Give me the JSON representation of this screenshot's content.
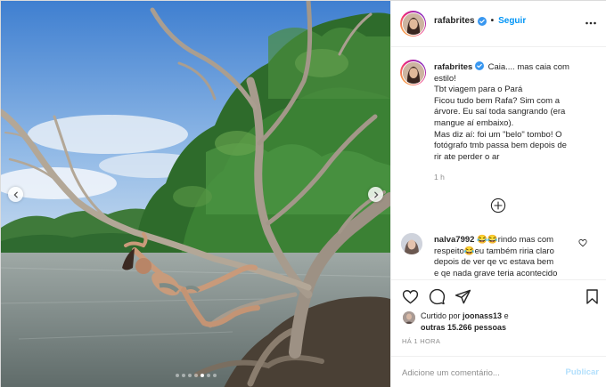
{
  "post": {
    "username": "rafabrites",
    "follow_label": "Seguir",
    "separator": "•",
    "caption_lines": [
      "Caia.... mas caia com",
      "estilo!",
      "Tbt viagem para o Pará",
      "Ficou tudo bem Rafa? Sim com a",
      "árvore. Eu saí toda sangrando (era",
      "mangue aí embaixo).",
      "Mas diz aí: foi um \"belo\" tombo! O",
      "fotógrafo tmb passa bem depois de",
      "rir ate perder o ar"
    ],
    "caption_time": "1 h",
    "carousel": {
      "total": 7,
      "active_index": 4
    }
  },
  "comment": {
    "username": "nalva7992",
    "lines": [
      "😂😂rindo mas com",
      "respeito😂eu também riria claro",
      "depois de ver qe vc estava bem",
      "e qe nada grave teria acontecido"
    ]
  },
  "likes": {
    "prefix": "Curtido por",
    "user": "joonass13",
    "mid": "e",
    "others": "outras 15.266 pessoas"
  },
  "posted_ago": "HÁ 1 HORA",
  "add_comment": {
    "placeholder": "Adicione um comentário...",
    "publish_label": "Publicar"
  },
  "icons": {
    "verified": "verified-badge-icon",
    "more": "more-options-icon",
    "load_more": "plus-circle-icon",
    "like": "heart-icon",
    "comment": "comment-bubble-icon",
    "share": "paper-plane-icon",
    "save": "bookmark-icon"
  },
  "colors": {
    "accent": "#0095f6",
    "publish_disabled": "#b2dffc",
    "muted": "#8e8e8e",
    "border": "#efefef"
  }
}
